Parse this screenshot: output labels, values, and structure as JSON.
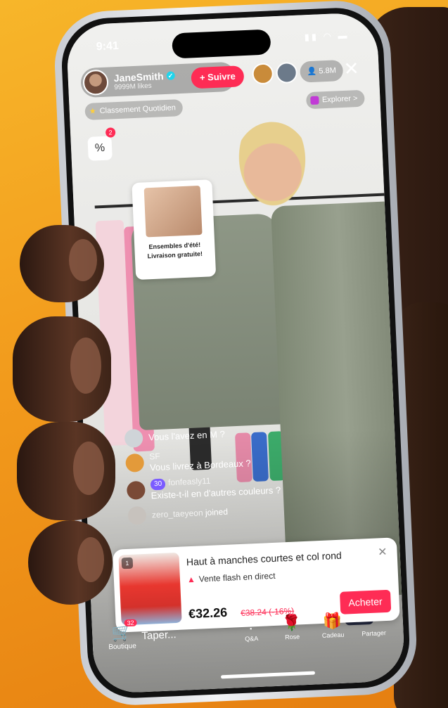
{
  "status": {
    "time": "9:41",
    "icons": "▮▮ ◠ ▬"
  },
  "host": {
    "name": "JaneSmith",
    "likes": "9999M likes",
    "follow_label": "+ Suivre"
  },
  "viewer_count": "5.8M",
  "ranking_label": "Classement Quotidien",
  "explore_label": "Explorer >",
  "promo": {
    "count": "2",
    "symbol": "%"
  },
  "pinned": {
    "text_line1": "Ensembles d'été!",
    "text_line2": "Livraison gratuite!"
  },
  "comments": [
    {
      "text": "Vous l'avez en M ?"
    },
    {
      "user": "SF",
      "text": "Vous livrez à Bordeaux ?"
    },
    {
      "level": "30",
      "user": "fonfeasly11",
      "text": "Existe-t-il en d'autres couleurs ?"
    }
  ],
  "joined": {
    "user": "zero_taeyeon",
    "text": "joined"
  },
  "product": {
    "number": "1",
    "title": "Haut à manches courtes et col rond",
    "flash_label": "Vente flash en direct",
    "price": "€32.26",
    "old_price": "€38.24 (-16%)",
    "buy_label": "Acheter",
    "close_icon": "✕"
  },
  "bottom": {
    "shop_label": "Boutique",
    "cart_count": "32",
    "input_placeholder": "Taper...",
    "actions": [
      {
        "icon": "?",
        "label": "Q&A"
      },
      {
        "icon": "🌹",
        "label": "Rose"
      },
      {
        "icon": "🎁",
        "label": "Cadeau"
      },
      {
        "icon": "↷",
        "label": "Partager"
      }
    ]
  },
  "colors": {
    "accent": "#fe2c55",
    "background": "#f29a1c"
  }
}
